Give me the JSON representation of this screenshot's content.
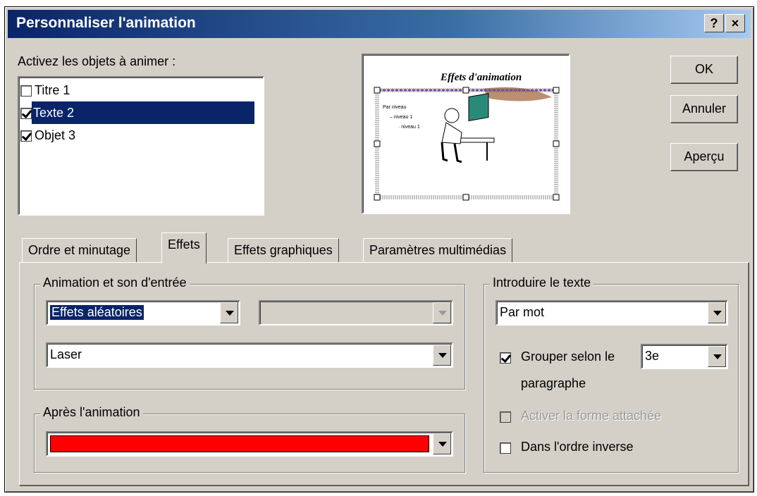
{
  "window": {
    "title": "Personnaliser l'animation",
    "help_btn": "?",
    "close_btn": "×"
  },
  "objects": {
    "label": "Activez les objets à animer :",
    "items": [
      {
        "label": "Titre 1",
        "checked": false
      },
      {
        "label": "Texte 2",
        "checked": true
      },
      {
        "label": "Objet 3",
        "checked": true
      }
    ]
  },
  "preview": {
    "slide_title": "Effets d'animation",
    "bullet1": "Par niveau",
    "bullet2": "– niveau 1",
    "bullet3": "· niveau 1"
  },
  "buttons": {
    "ok": "OK",
    "cancel": "Annuler",
    "preview": "Aperçu"
  },
  "tabs": [
    "Ordre et minutage",
    "Effets",
    "Effets graphiques",
    "Paramètres multimédias"
  ],
  "entry": {
    "group_title": "Animation et son d'entrée",
    "effect": "Effets aléatoires",
    "direction": "",
    "sound": "Laser"
  },
  "after": {
    "group_title": "Après l'animation",
    "color": "#ff0000"
  },
  "text_intro": {
    "group_title": "Introduire le texte",
    "mode": "Par mot",
    "group_by_label": "Grouper selon le",
    "group_by_value": "3e",
    "paragraph_label": "paragraphe",
    "attach_label": "Activer la forme attachée",
    "reverse_label": "Dans l'ordre inverse"
  }
}
